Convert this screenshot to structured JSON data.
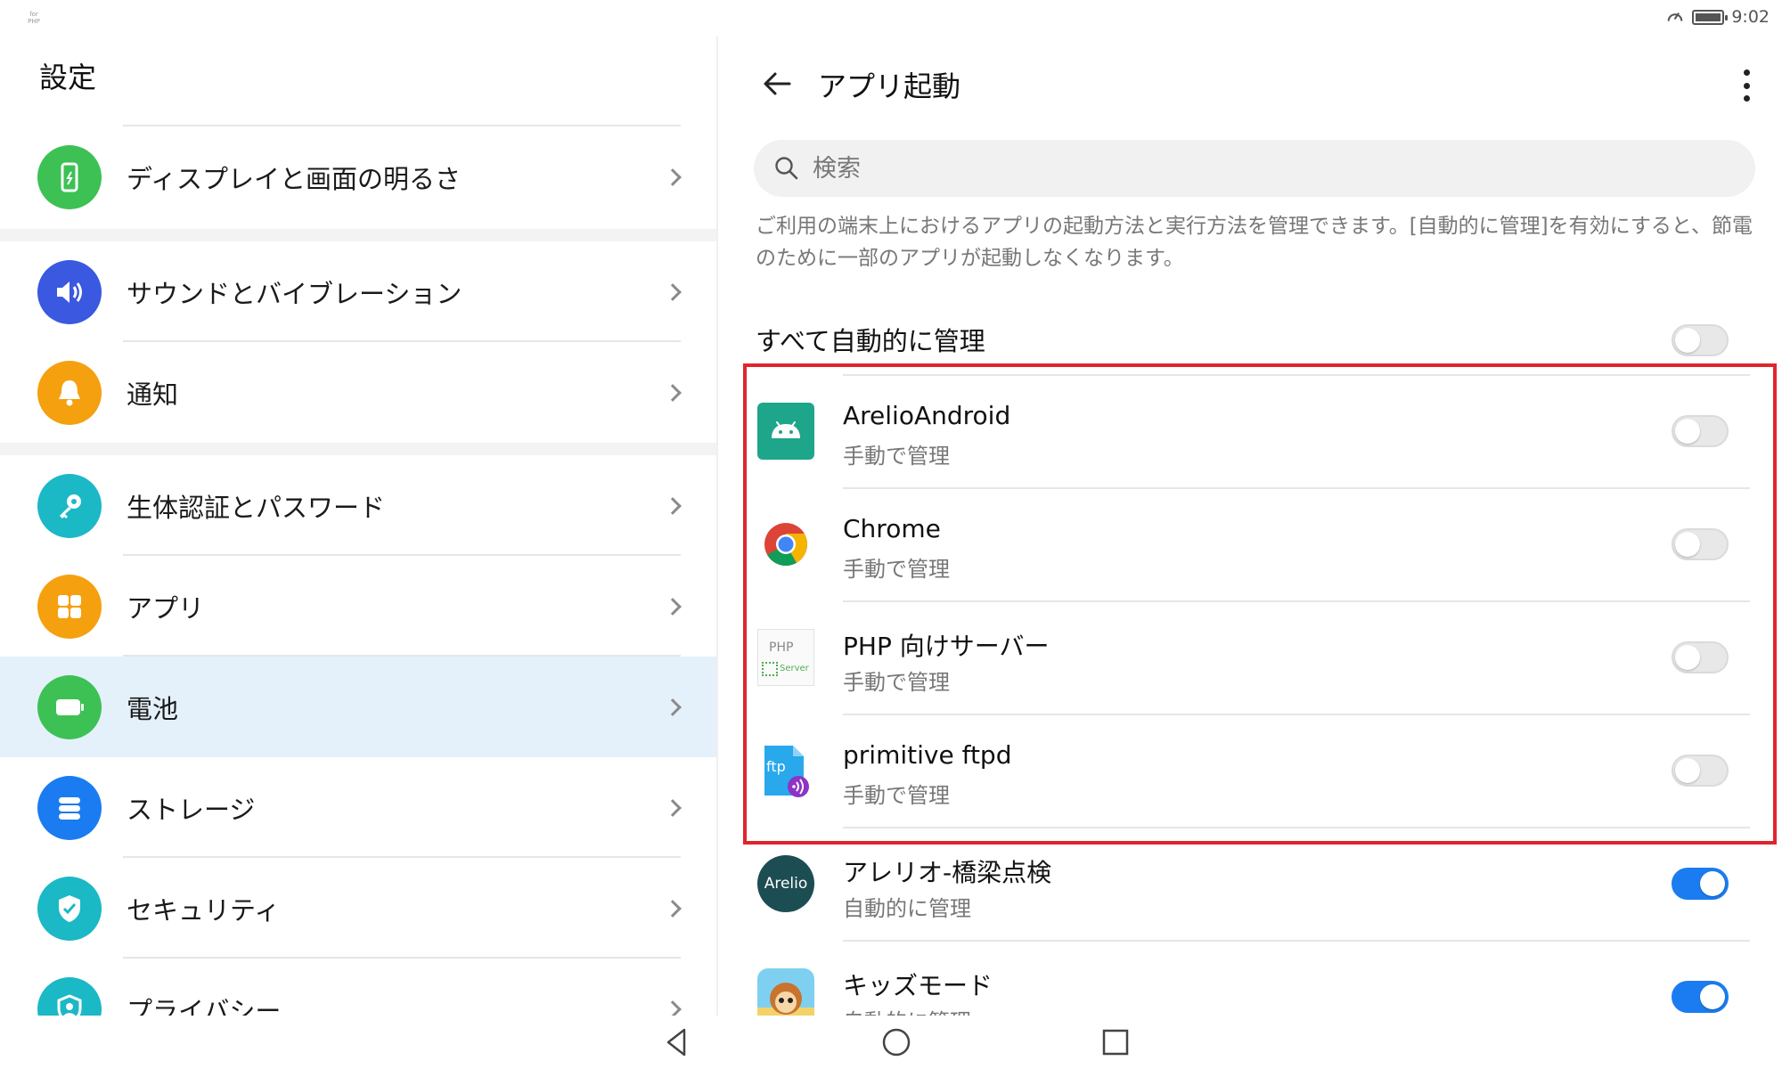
{
  "status_bar": {
    "app_icon_text": "for PHP",
    "time": "9:02",
    "battery_level": 1.0,
    "icons": [
      "speed-icon",
      "battery-icon"
    ]
  },
  "settings": {
    "title": "設定",
    "items": [
      {
        "label": "ディスプレイと画面の明るさ",
        "icon": "display-icon",
        "color": "#3dc155",
        "selected": false
      },
      {
        "label": "サウンドとバイブレーション",
        "icon": "sound-icon",
        "color": "#3a58e0",
        "selected": false
      },
      {
        "label": "通知",
        "icon": "bell-icon",
        "color": "#f5a00f",
        "selected": false
      },
      {
        "label": "生体認証とパスワード",
        "icon": "key-icon",
        "color": "#1bb8c6",
        "selected": false
      },
      {
        "label": "アプリ",
        "icon": "apps-icon",
        "color": "#f5a00f",
        "selected": false
      },
      {
        "label": "電池",
        "icon": "battery-icon",
        "color": "#3dc155",
        "selected": true
      },
      {
        "label": "ストレージ",
        "icon": "storage-icon",
        "color": "#1a7cf0",
        "selected": false
      },
      {
        "label": "セキュリティ",
        "icon": "shield-icon",
        "color": "#1bb8c6",
        "selected": false
      },
      {
        "label": "プライバシー",
        "icon": "privacy-icon",
        "color": "#1bb8c6",
        "selected": false
      }
    ]
  },
  "app_launch": {
    "title": "アプリ起動",
    "search_placeholder": "検索",
    "description": "ご利用の端末上におけるアプリの起動方法と実行方法を管理できます。[自動的に管理]を有効にすると、節電のために一部のアプリが起動しなくなります。",
    "manage_all_label": "すべて自動的に管理",
    "manage_all_on": false,
    "apps": [
      {
        "name": "ArelioAndroid",
        "status": "手動で管理",
        "on": false,
        "icon": "android-icon"
      },
      {
        "name": "Chrome",
        "status": "手動で管理",
        "on": false,
        "icon": "chrome-icon"
      },
      {
        "name": "PHP 向けサーバー",
        "status": "手動で管理",
        "on": false,
        "icon": "php-server-icon",
        "icon_text": [
          "PHP",
          "Server"
        ]
      },
      {
        "name": "primitive ftpd",
        "status": "手動で管理",
        "on": false,
        "icon": "ftp-icon",
        "icon_text": "ftp"
      },
      {
        "name": "アレリオ-橋梁点検",
        "status": "自動的に管理",
        "on": true,
        "icon": "arelio-icon",
        "icon_text": "Arelio"
      },
      {
        "name": "キッズモード",
        "status": "自動的に管理",
        "on": true,
        "icon": "kids-mode-icon"
      }
    ],
    "highlight_color": "#e0242c"
  },
  "nav_bar": {
    "buttons": [
      "back-nav-icon",
      "home-nav-icon",
      "recents-nav-icon"
    ]
  }
}
